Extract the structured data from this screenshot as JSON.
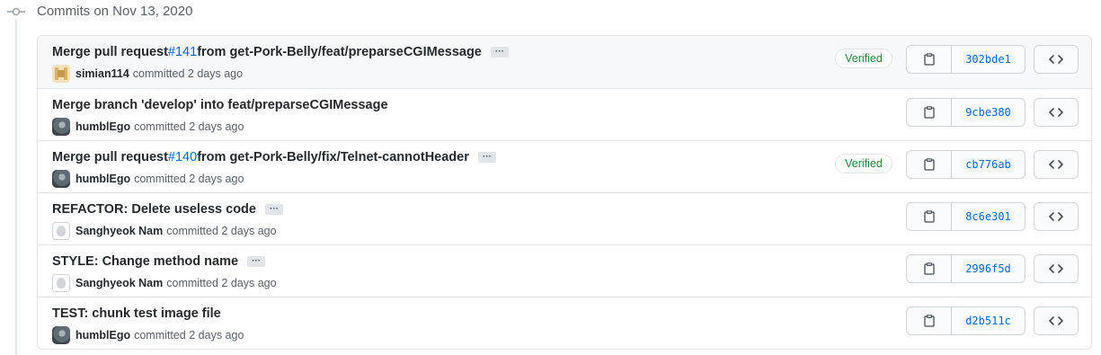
{
  "group": {
    "title": "Commits on Nov 13, 2020"
  },
  "commits": [
    {
      "title_prefix": "Merge pull request ",
      "pr": "#141",
      "title_suffix": " from get-Pork-Belly/feat/preparseCGIMessage",
      "has_ellipsis": true,
      "ellipsis": "···",
      "author": "simian114",
      "action": "committed",
      "time": "2 days ago",
      "avatar": "pixel",
      "verified": "Verified",
      "sha": "302bde1"
    },
    {
      "title_prefix": "Merge branch 'develop' into feat/preparseCGIMessage",
      "pr": "",
      "title_suffix": "",
      "has_ellipsis": false,
      "ellipsis": "",
      "author": "humblEgo",
      "action": "committed",
      "time": "2 days ago",
      "avatar": "photo",
      "verified": "",
      "sha": "9cbe380"
    },
    {
      "title_prefix": "Merge pull request ",
      "pr": "#140",
      "title_suffix": " from get-Pork-Belly/fix/Telnet-cannotHeader",
      "has_ellipsis": true,
      "ellipsis": "···",
      "author": "humblEgo",
      "action": "committed",
      "time": "2 days ago",
      "avatar": "photo",
      "verified": "Verified",
      "sha": "cb776ab"
    },
    {
      "title_prefix": "REFACTOR: Delete useless code",
      "pr": "",
      "title_suffix": "",
      "has_ellipsis": true,
      "ellipsis": "···",
      "author": "Sanghyeok Nam",
      "action": "committed",
      "time": "2 days ago",
      "avatar": "default",
      "verified": "",
      "sha": "8c6e301"
    },
    {
      "title_prefix": "STYLE: Change method name",
      "pr": "",
      "title_suffix": "",
      "has_ellipsis": true,
      "ellipsis": "···",
      "author": "Sanghyeok Nam",
      "action": "committed",
      "time": "2 days ago",
      "avatar": "default",
      "verified": "",
      "sha": "2996f5d"
    },
    {
      "title_prefix": "TEST: chunk test image file",
      "pr": "",
      "title_suffix": "",
      "has_ellipsis": false,
      "ellipsis": "",
      "author": "humblEgo",
      "action": "committed",
      "time": "2 days ago",
      "avatar": "photo",
      "verified": "",
      "sha": "d2b511c"
    }
  ],
  "colors": {
    "link": "#0366d6",
    "verified": "#22863a",
    "muted": "#586069",
    "border": "#e1e4e8"
  },
  "icons": {
    "group": "git-commit-icon",
    "copy": "clipboard-icon",
    "browse": "code-icon"
  }
}
